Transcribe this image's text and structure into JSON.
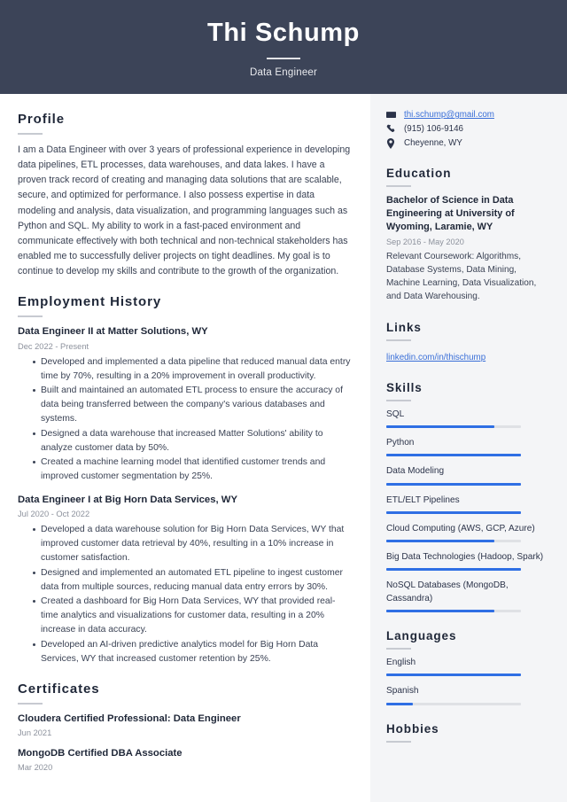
{
  "header": {
    "name": "Thi Schump",
    "title": "Data Engineer"
  },
  "main": {
    "profile": {
      "heading": "Profile",
      "text": "I am a Data Engineer with over 3 years of professional experience in developing data pipelines, ETL processes, data warehouses, and data lakes. I have a proven track record of creating and managing data solutions that are scalable, secure, and optimized for performance. I also possess expertise in data modeling and analysis, data visualization, and programming languages such as Python and SQL. My ability to work in a fast-paced environment and communicate effectively with both technical and non-technical stakeholders has enabled me to successfully deliver projects on tight deadlines. My goal is to continue to develop my skills and contribute to the growth of the organization."
    },
    "employment": {
      "heading": "Employment History",
      "jobs": [
        {
          "title": "Data Engineer II at Matter Solutions, WY",
          "date": "Dec 2022 - Present",
          "bullets": [
            "Developed and implemented a data pipeline that reduced manual data entry time by 70%, resulting in a 20% improvement in overall productivity.",
            "Built and maintained an automated ETL process to ensure the accuracy of data being transferred between the company's various databases and systems.",
            "Designed a data warehouse that increased Matter Solutions' ability to analyze customer data by 50%.",
            "Created a machine learning model that identified customer trends and improved customer segmentation by 25%."
          ]
        },
        {
          "title": "Data Engineer I at Big Horn Data Services, WY",
          "date": "Jul 2020 - Oct 2022",
          "bullets": [
            "Developed a data warehouse solution for Big Horn Data Services, WY that improved customer data retrieval by 40%, resulting in a 10% increase in customer satisfaction.",
            "Designed and implemented an automated ETL pipeline to ingest customer data from multiple sources, reducing manual data entry errors by 30%.",
            "Created a dashboard for Big Horn Data Services, WY that provided real-time analytics and visualizations for customer data, resulting in a 20% increase in data accuracy.",
            "Developed an AI-driven predictive analytics model for Big Horn Data Services, WY that increased customer retention by 25%."
          ]
        }
      ]
    },
    "certificates": {
      "heading": "Certificates",
      "items": [
        {
          "title": "Cloudera Certified Professional: Data Engineer",
          "date": "Jun 2021"
        },
        {
          "title": "MongoDB Certified DBA Associate",
          "date": "Mar 2020"
        }
      ]
    }
  },
  "sidebar": {
    "contact": {
      "email": "thi.schump@gmail.com",
      "phone": "(915) 106-9146",
      "location": "Cheyenne, WY"
    },
    "education": {
      "heading": "Education",
      "degree": "Bachelor of Science in Data Engineering at University of Wyoming, Laramie, WY",
      "date": "Sep 2016 - May 2020",
      "description": "Relevant Coursework: Algorithms, Database Systems, Data Mining, Machine Learning, Data Visualization, and Data Warehousing."
    },
    "links": {
      "heading": "Links",
      "items": [
        {
          "label": "linkedin.com/in/thischump"
        }
      ]
    },
    "skills": {
      "heading": "Skills",
      "items": [
        {
          "label": "SQL",
          "level": 80
        },
        {
          "label": "Python",
          "level": 100
        },
        {
          "label": "Data Modeling",
          "level": 100
        },
        {
          "label": "ETL/ELT Pipelines",
          "level": 100
        },
        {
          "label": "Cloud Computing (AWS, GCP, Azure)",
          "level": 80
        },
        {
          "label": "Big Data Technologies (Hadoop, Spark)",
          "level": 100
        },
        {
          "label": "NoSQL Databases (MongoDB, Cassandra)",
          "level": 80
        }
      ]
    },
    "languages": {
      "heading": "Languages",
      "items": [
        {
          "label": "English",
          "level": 100
        },
        {
          "label": "Spanish",
          "level": 20
        }
      ]
    },
    "hobbies": {
      "heading": "Hobbies"
    }
  },
  "colors": {
    "header_bg": "#3c4458",
    "sidebar_bg": "#f4f5f7",
    "accent_blue": "#2f6fe4",
    "link_blue": "#3a6fd8",
    "heading_dark": "#1f2738",
    "body_text": "#3a4254",
    "muted_text": "#8c919c",
    "bar_track": "#dfe1e5"
  }
}
